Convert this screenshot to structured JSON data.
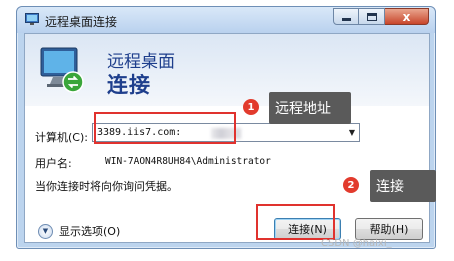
{
  "window": {
    "title": "远程桌面连接",
    "close_glyph": "x"
  },
  "header": {
    "title": "远程桌面",
    "subtitle": "连接"
  },
  "form": {
    "computer_label": "计算机(C):",
    "computer_value": "3389.iis7.com:",
    "user_label": "用户名:",
    "user_value": "WIN-7AON4R8UH84\\Administrator",
    "note": "当你连接时将向你询问凭据。"
  },
  "footer": {
    "options_label": "显示选项(O)",
    "connect_label": "连接(N)",
    "help_label": "帮助(H)"
  },
  "annotations": {
    "marker1": "1",
    "callout1": "远程地址",
    "marker2": "2",
    "callout2": "连接",
    "highlight_color": "#e0322e",
    "callout_color": "#5a5a5a"
  },
  "watermark": "CSDN @haixi_"
}
